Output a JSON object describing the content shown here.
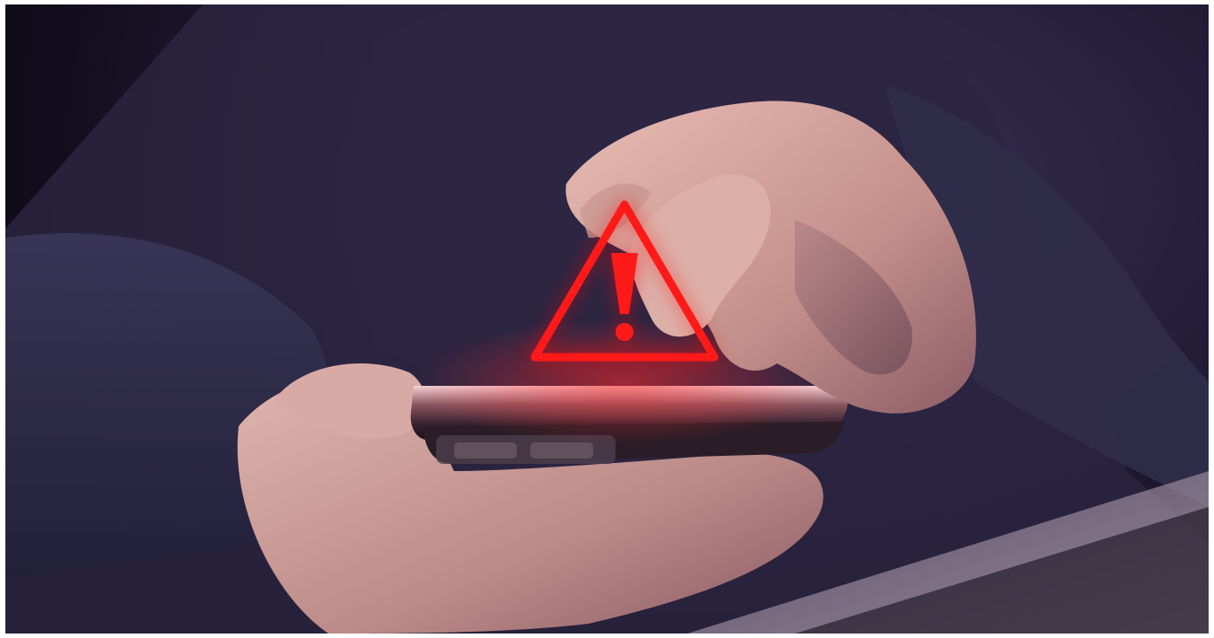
{
  "scene": {
    "subject": "hand-holding-smartphone",
    "icon": "warning-triangle-icon"
  },
  "colors": {
    "warning_red": "#ff1a1a",
    "background_dark": "#1a1428",
    "sleeve_navy": "#2f2c4a",
    "skin": "#d9a7a0",
    "phone_metal": "#3a2f36"
  }
}
